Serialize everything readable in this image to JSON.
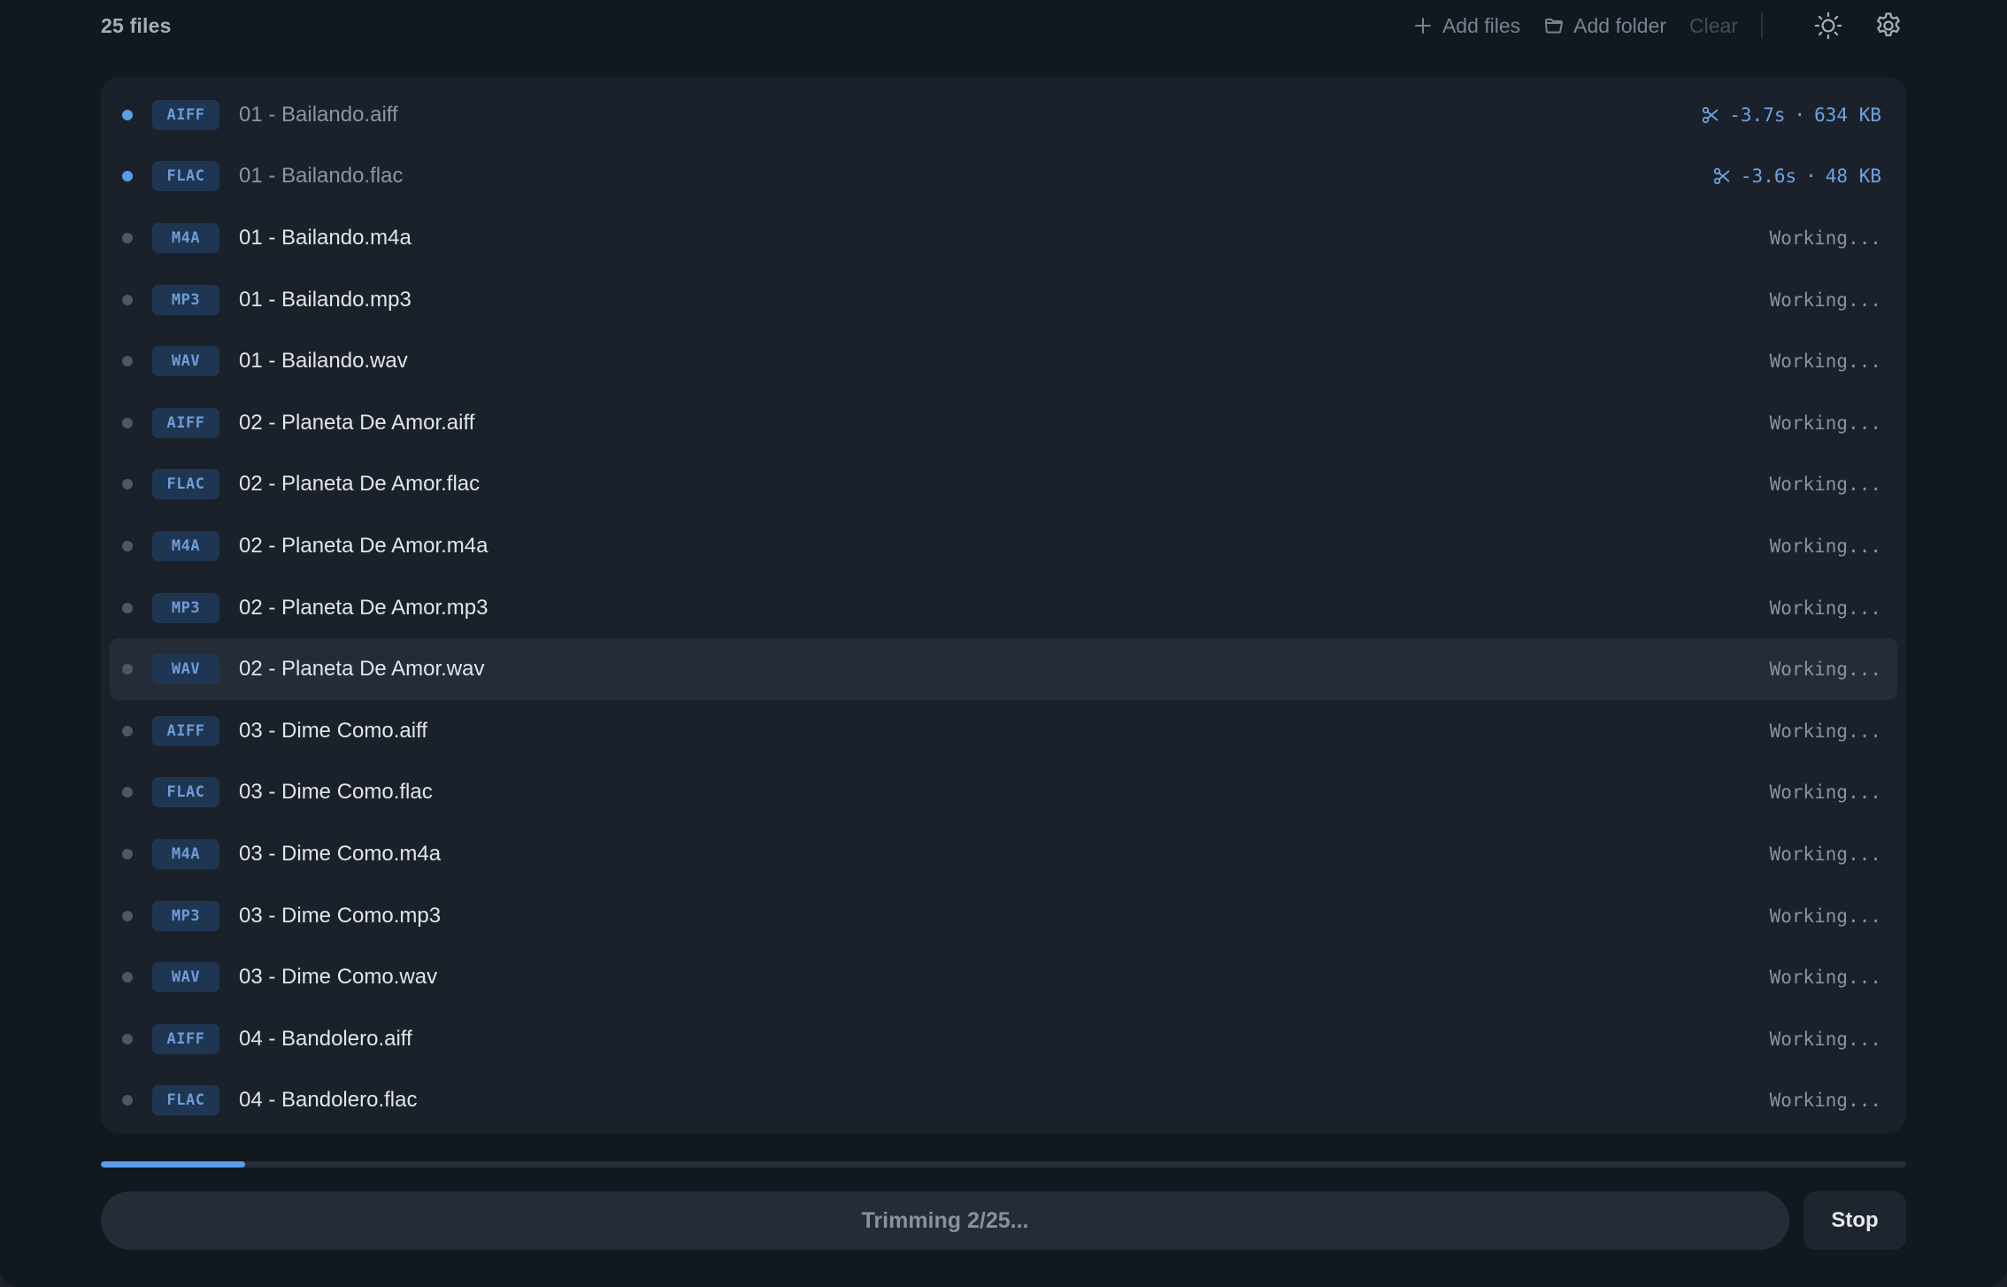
{
  "header": {
    "file_count": "25 files",
    "add_files_label": "Add files",
    "add_folder_label": "Add folder",
    "clear_label": "Clear"
  },
  "files": [
    {
      "format": "AIFF",
      "name": "01 - Bailando.aiff",
      "state": "done",
      "trim": "-3.7s",
      "sep": "·",
      "size": "634 KB"
    },
    {
      "format": "FLAC",
      "name": "01 - Bailando.flac",
      "state": "done",
      "trim": "-3.6s",
      "sep": "·",
      "size": "48 KB"
    },
    {
      "format": "M4A",
      "name": "01 - Bailando.m4a",
      "state": "working",
      "status": "Working..."
    },
    {
      "format": "MP3",
      "name": "01 - Bailando.mp3",
      "state": "working",
      "status": "Working..."
    },
    {
      "format": "WAV",
      "name": "01 - Bailando.wav",
      "state": "working",
      "status": "Working..."
    },
    {
      "format": "AIFF",
      "name": "02 - Planeta De Amor.aiff",
      "state": "working",
      "status": "Working..."
    },
    {
      "format": "FLAC",
      "name": "02 - Planeta De Amor.flac",
      "state": "working",
      "status": "Working..."
    },
    {
      "format": "M4A",
      "name": "02 - Planeta De Amor.m4a",
      "state": "working",
      "status": "Working..."
    },
    {
      "format": "MP3",
      "name": "02 - Planeta De Amor.mp3",
      "state": "working",
      "status": "Working..."
    },
    {
      "format": "WAV",
      "name": "02 - Planeta De Amor.wav",
      "state": "working",
      "status": "Working...",
      "highlight": true
    },
    {
      "format": "AIFF",
      "name": "03 - Dime Como.aiff",
      "state": "working",
      "status": "Working..."
    },
    {
      "format": "FLAC",
      "name": "03 - Dime Como.flac",
      "state": "working",
      "status": "Working..."
    },
    {
      "format": "M4A",
      "name": "03 - Dime Como.m4a",
      "state": "working",
      "status": "Working..."
    },
    {
      "format": "MP3",
      "name": "03 - Dime Como.mp3",
      "state": "working",
      "status": "Working..."
    },
    {
      "format": "WAV",
      "name": "03 - Dime Como.wav",
      "state": "working",
      "status": "Working..."
    },
    {
      "format": "AIFF",
      "name": "04 - Bandolero.aiff",
      "state": "working",
      "status": "Working..."
    },
    {
      "format": "FLAC",
      "name": "04 - Bandolero.flac",
      "state": "working",
      "status": "Working..."
    }
  ],
  "progress": {
    "fraction": 0.08
  },
  "footer": {
    "status_text": "Trimming 2/25...",
    "stop_label": "Stop"
  },
  "colors": {
    "accent": "#5b9be8",
    "badge_bg": "#1f3652",
    "badge_text": "#6f9cd6"
  },
  "icons": {
    "add_files": "plus-icon",
    "add_folder": "folder-icon",
    "theme": "sun-icon",
    "settings": "gear-icon",
    "trimmed": "scissors-icon"
  }
}
